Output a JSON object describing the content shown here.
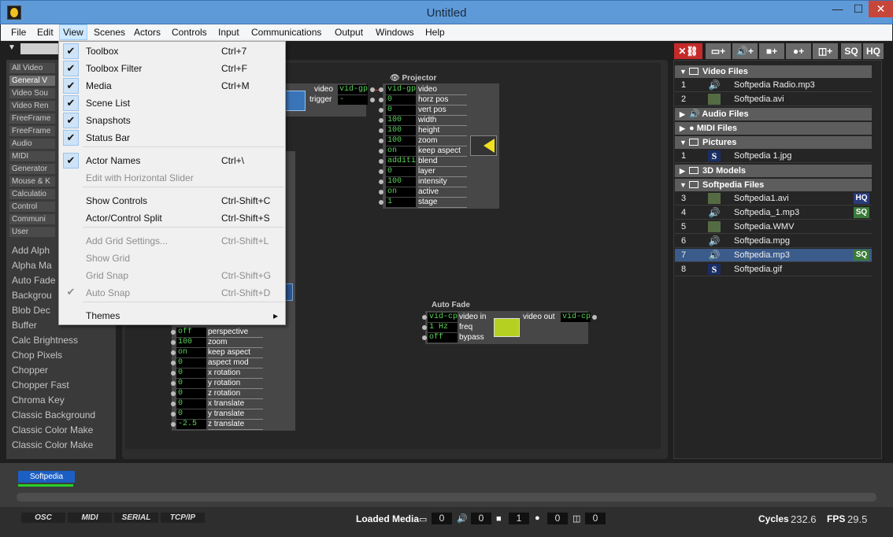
{
  "window": {
    "title": "Untitled",
    "minimize": "—",
    "maximize": "☐",
    "close": "✕"
  },
  "menubar": [
    "File",
    "Edit",
    "View",
    "Scenes",
    "Actors",
    "Controls",
    "Input",
    "Communications",
    "Output",
    "Windows",
    "Help"
  ],
  "view_menu": [
    {
      "label": "Toolbox",
      "shortcut": "Ctrl+7",
      "checked": true,
      "enabled": true
    },
    {
      "label": "Toolbox Filter",
      "shortcut": "Ctrl+F",
      "checked": true,
      "enabled": true
    },
    {
      "label": "Media",
      "shortcut": "Ctrl+M",
      "checked": true,
      "enabled": true
    },
    {
      "label": "Scene List",
      "shortcut": "",
      "checked": true,
      "enabled": true
    },
    {
      "label": "Snapshots",
      "shortcut": "",
      "checked": true,
      "enabled": true
    },
    {
      "label": "Status Bar",
      "shortcut": "",
      "checked": true,
      "enabled": true
    },
    {
      "label": "Actor Names",
      "shortcut": "Ctrl+\\",
      "checked": true,
      "enabled": true
    },
    {
      "label": "Edit with Horizontal Slider",
      "shortcut": "",
      "checked": false,
      "enabled": false
    },
    {
      "label": "Show Controls",
      "shortcut": "Ctrl-Shift+C",
      "checked": false,
      "enabled": true
    },
    {
      "label": "Actor/Control Split",
      "shortcut": "Ctrl-Shift+S",
      "checked": false,
      "enabled": true
    },
    {
      "label": "Add Grid Settings...",
      "shortcut": "Ctrl-Shift+L",
      "checked": false,
      "enabled": false
    },
    {
      "label": "Show Grid",
      "shortcut": "",
      "checked": false,
      "enabled": false
    },
    {
      "label": "Grid Snap",
      "shortcut": "Ctrl-Shift+G",
      "checked": false,
      "enabled": false
    },
    {
      "label": "Auto Snap",
      "shortcut": "Ctrl-Shift+D",
      "checked": true,
      "enabled": false
    },
    {
      "label": "Themes",
      "shortcut": "",
      "checked": false,
      "enabled": true,
      "submenu": "▸"
    }
  ],
  "categories": [
    "All Video",
    "General V",
    "Video Sou",
    "Video Ren",
    "FreeFrame",
    "FreeFrame",
    "Audio",
    "MIDI",
    "Generator",
    "Mouse & K",
    "Calculatio",
    "Control",
    "Communi",
    "User"
  ],
  "actors_list": [
    "Add Alph",
    "Alpha Ma",
    "Auto Fade",
    "Backgrou",
    "Blob Dec",
    "Buffer",
    "Calc Brightness",
    "Chop Pixels",
    "Chopper",
    "Chopper Fast",
    "Chroma Key",
    "Classic Background",
    "Classic Color Make",
    "Classic Color Make"
  ],
  "stage": {
    "movie_player": {
      "outputs": [
        {
          "label": "video",
          "value": "vid-gpu"
        },
        {
          "label": "trigger",
          "value": "-"
        }
      ]
    },
    "projector": {
      "title": "Projector",
      "inputs": [
        {
          "value": "vid-gpu",
          "label": "video"
        },
        {
          "value": "0",
          "label": "horz pos"
        },
        {
          "value": "0",
          "label": "vert pos"
        },
        {
          "value": "100",
          "label": "width"
        },
        {
          "value": "100",
          "label": "height"
        },
        {
          "value": "100",
          "label": "zoom"
        },
        {
          "value": "on",
          "label": "keep aspect"
        },
        {
          "value": "additive",
          "label": "blend"
        },
        {
          "value": "0",
          "label": "layer"
        },
        {
          "value": "100",
          "label": "intensity"
        },
        {
          "value": "on",
          "label": "active"
        },
        {
          "value": "1",
          "label": "stage"
        }
      ]
    },
    "auto_fade": {
      "title": "Auto Fade",
      "inputs": [
        {
          "value": "vid-cpu",
          "label": "video in"
        },
        {
          "value": "1 Hz",
          "label": "freq"
        },
        {
          "value": "off",
          "label": "bypass"
        }
      ],
      "output": {
        "label": "video out",
        "value": "vid-cpu"
      }
    },
    "renderer": {
      "inputs": [
        {
          "value": "off",
          "label": "perspective"
        },
        {
          "value": "100",
          "label": "zoom"
        },
        {
          "value": "on",
          "label": "keep aspect"
        },
        {
          "value": "0",
          "label": "aspect mod"
        },
        {
          "value": "0",
          "label": "x rotation"
        },
        {
          "value": "0",
          "label": "y rotation"
        },
        {
          "value": "0",
          "label": "z rotation"
        },
        {
          "value": "0",
          "label": "x translate"
        },
        {
          "value": "0",
          "label": "y translate"
        },
        {
          "value": "-2.5",
          "label": "z translate"
        }
      ]
    }
  },
  "media_toolbar": {
    "sq": "SQ",
    "hq": "HQ"
  },
  "media": {
    "sections": {
      "video": "Video Files",
      "audio": "Audio Files",
      "midi": "MIDI Files",
      "pictures": "Pictures",
      "models": "3D Models",
      "softpedia": "Softpedia Files"
    },
    "video_files": [
      {
        "n": "1",
        "name": "Softpedia Radio.mp3",
        "kind": "audio"
      },
      {
        "n": "2",
        "name": "Softpedia.avi",
        "kind": "video"
      }
    ],
    "pictures": [
      {
        "n": "1",
        "name": "Softpedia 1.jpg",
        "kind": "s"
      }
    ],
    "softpedia_files": [
      {
        "n": "3",
        "name": "Softpedia1.avi",
        "kind": "video",
        "badge": "HQ"
      },
      {
        "n": "4",
        "name": "Softpedia_1.mp3",
        "kind": "audio",
        "badge": "SQ"
      },
      {
        "n": "5",
        "name": "Softpedia.WMV",
        "kind": "video",
        "badge": ""
      },
      {
        "n": "6",
        "name": "Softpedia.mpg",
        "kind": "audio",
        "badge": ""
      },
      {
        "n": "7",
        "name": "Softpedia.mp3",
        "kind": "audio",
        "badge": "SQ",
        "selected": true
      },
      {
        "n": "8",
        "name": "Softpedia.gif",
        "kind": "s",
        "badge": ""
      }
    ]
  },
  "scene_tab": "Softpedia",
  "status": {
    "tags": [
      "OSC",
      "MIDI",
      "SERIAL",
      "TCP/IP"
    ],
    "loaded_media_label": "Loaded Media",
    "counts": [
      "0",
      "0",
      "1",
      "0",
      "0"
    ],
    "cycles_label": "Cycles",
    "cycles_value": "232.6",
    "fps_label": "FPS",
    "fps_value": "29.5"
  },
  "colors": {
    "titlebar": "#5f9ad8",
    "menu_highlight": "#cde8ff",
    "value_text": "#5ad35a",
    "selected_row": "#3b5b8a",
    "hq": "#2a3b7a",
    "sq": "#3a7a3a"
  }
}
